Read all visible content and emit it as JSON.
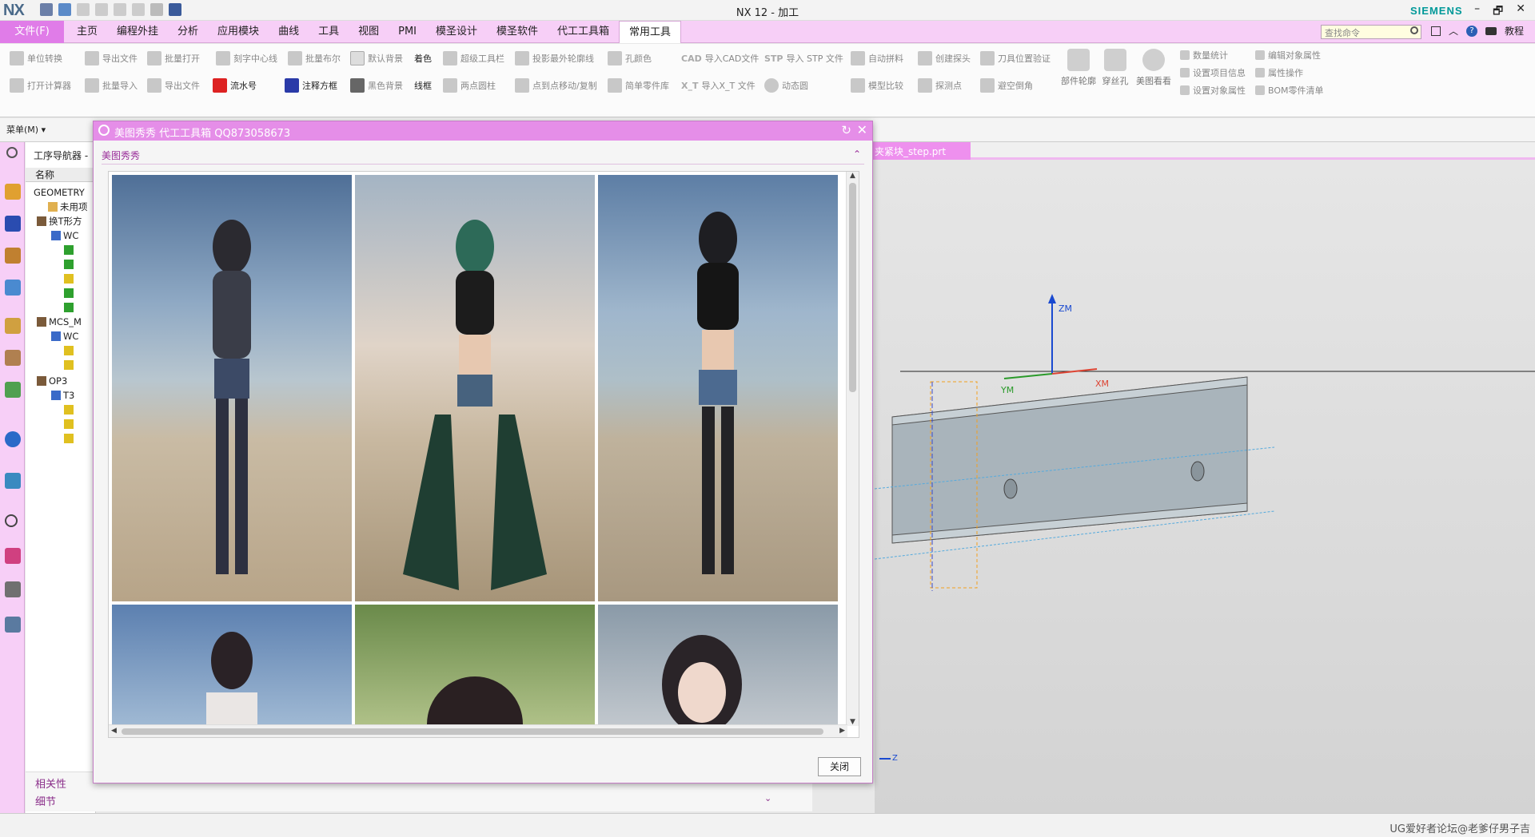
{
  "app": {
    "logo": "NX",
    "window_title": "NX 12 - 加工",
    "brand": "SIEMENS",
    "window_controls": [
      "–",
      "🗗",
      "✕"
    ]
  },
  "menubar": {
    "file": "文件(F)",
    "tabs": [
      "主页",
      "编程外挂",
      "分析",
      "应用模块",
      "曲线",
      "工具",
      "视图",
      "PMI",
      "模圣设计",
      "模圣软件",
      "代工工具箱",
      "常用工具"
    ],
    "active_tab": "常用工具",
    "search_placeholder": "查找命令",
    "tutorial": "教程"
  },
  "ribbon": {
    "row1": [
      "单位转换",
      "导出文件",
      "批量打开",
      "刻字中心线",
      "批量布尔",
      "默认背景",
      "着色",
      "超级工具栏",
      "投影最外轮廓线",
      "孔颜色",
      "导入CAD文件",
      "导入 STP 文件",
      "自动拼料",
      "创建探头",
      "刀具位置验证"
    ],
    "row2": [
      "打开计算器",
      "批量导入",
      "导出文件",
      "流水号",
      "注释方框",
      "黑色背景",
      "线框",
      "两点圆柱",
      "点到点移动/复制",
      "简单零件库",
      "导入X_T 文件",
      "动态圆",
      "模型比较",
      "探测点",
      "避空倒角"
    ],
    "big": [
      "部件轮廓",
      "穿丝孔",
      "美图看看"
    ],
    "right": [
      "数量统计",
      "编辑对象属性",
      "设置项目信息",
      "属性操作",
      "设置对象属性",
      "BOM零件清单"
    ],
    "stp_badge": "STP",
    "cad_badge": "CAD",
    "xt_badge": "X_T"
  },
  "toolbar": {
    "menu_label": "菜单(M) ▾"
  },
  "navigator": {
    "title": "工序导航器 -",
    "col_header": "名称",
    "rows": [
      "GEOMETRY",
      "未用项",
      "换T形方",
      "WC",
      "",
      "",
      "",
      "",
      "",
      "MCS_M",
      "WC",
      "",
      "",
      "OP3",
      "T3",
      "",
      "",
      ""
    ]
  },
  "bottom_panel": {
    "related": "相关性",
    "details": "细节"
  },
  "dialog": {
    "title": "美图秀秀 代工工具箱 QQ873058673",
    "group": "美图秀秀",
    "close_button": "关闭"
  },
  "viewport": {
    "file_tab": "夹紧块_step.prt",
    "axis_zm": "ZM",
    "axis_ym": "YM",
    "axis_xm": "XM",
    "triad_z": "Z"
  },
  "status": {
    "watermark": "UG爱好者论坛@老爹仔男子吉"
  }
}
